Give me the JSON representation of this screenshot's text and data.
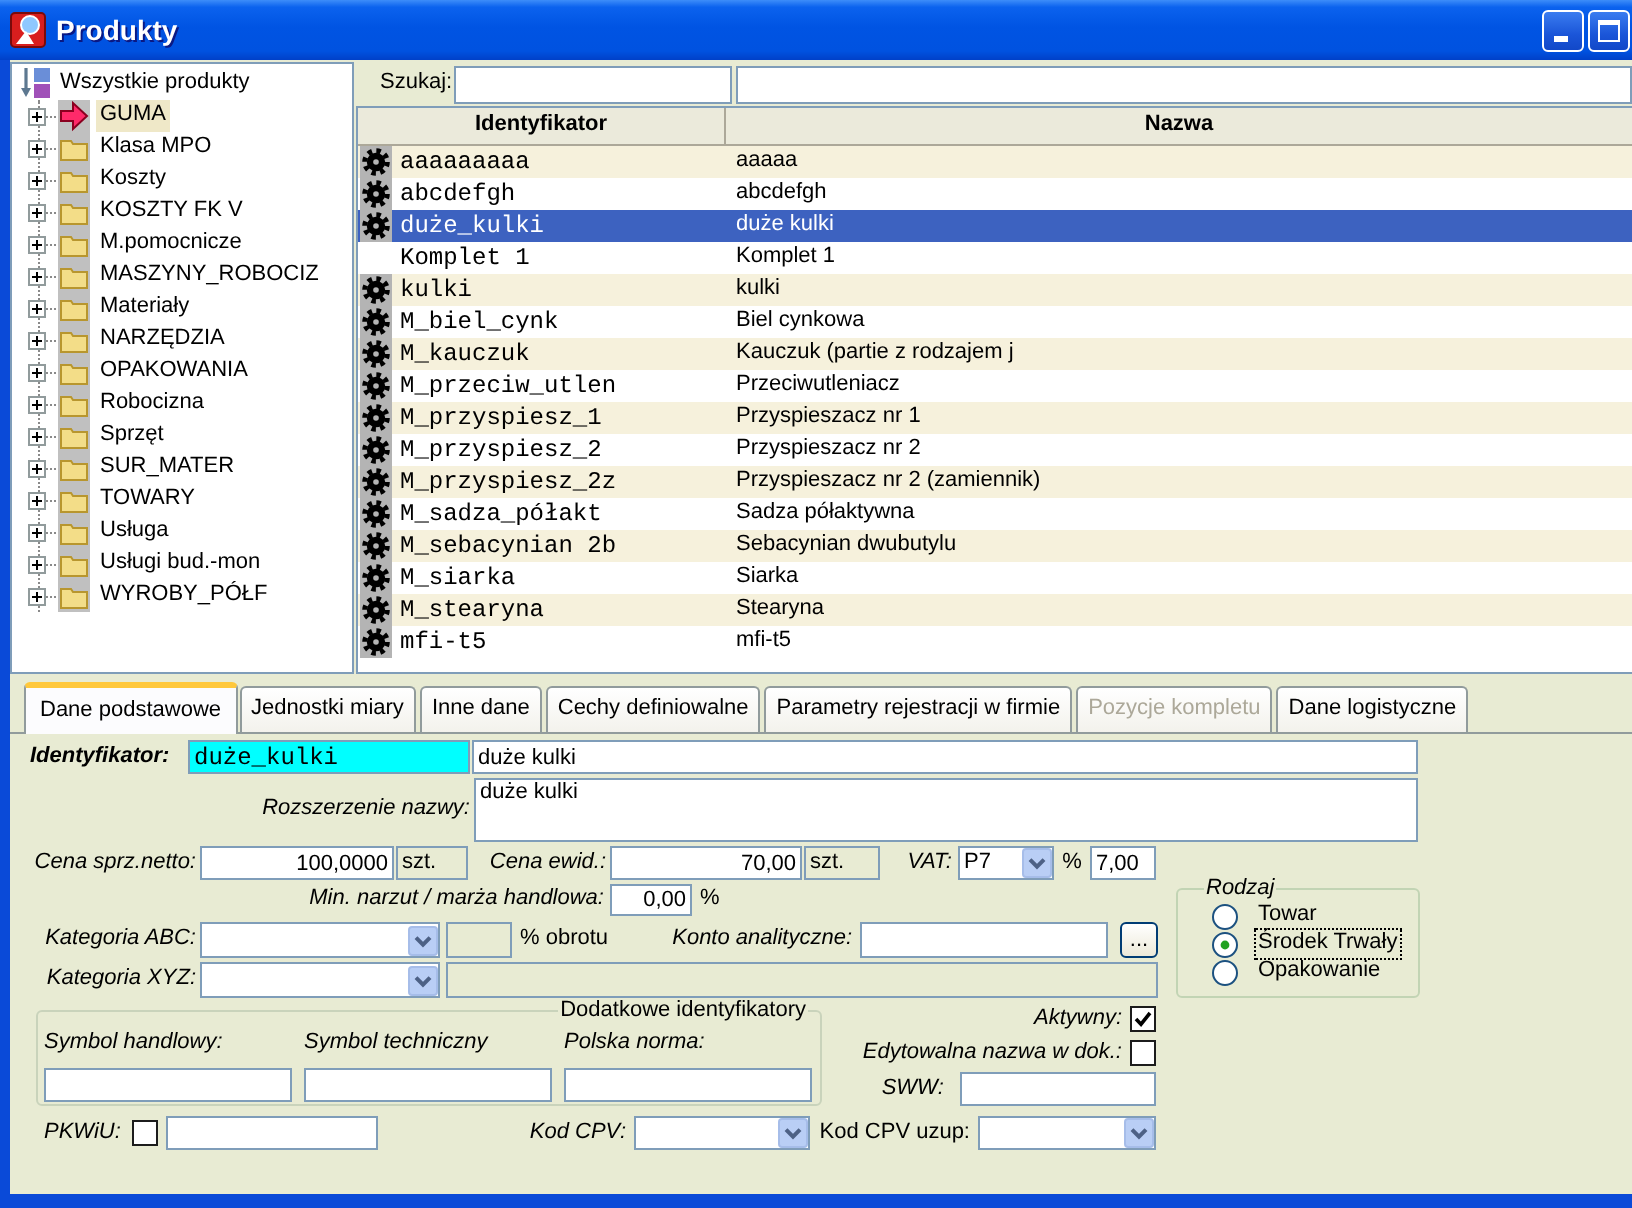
{
  "window": {
    "title": "Produkty"
  },
  "tree": {
    "root": "Wszystkie produkty",
    "items": [
      {
        "label": "GUMA",
        "selected": true,
        "expanded": false
      },
      {
        "label": "Klasa MPO",
        "selected": false,
        "expanded": false
      },
      {
        "label": "Koszty",
        "selected": false,
        "expanded": false
      },
      {
        "label": "KOSZTY FK V",
        "selected": false,
        "expanded": false
      },
      {
        "label": "M.pomocnicze",
        "selected": false,
        "expanded": false
      },
      {
        "label": "MASZYNY_ROBOCIZ",
        "selected": false,
        "expanded": false
      },
      {
        "label": "Materiały",
        "selected": false,
        "expanded": false
      },
      {
        "label": "NARZĘDZIA",
        "selected": false,
        "expanded": false
      },
      {
        "label": "OPAKOWANIA",
        "selected": false,
        "expanded": false
      },
      {
        "label": "Robocizna",
        "selected": false,
        "expanded": false
      },
      {
        "label": "Sprzęt",
        "selected": false,
        "expanded": false
      },
      {
        "label": "SUR_MATER",
        "selected": false,
        "expanded": false
      },
      {
        "label": "TOWARY",
        "selected": false,
        "expanded": false
      },
      {
        "label": "Usługa",
        "selected": false,
        "expanded": false
      },
      {
        "label": "Usługi bud.-mon",
        "selected": false,
        "expanded": false
      },
      {
        "label": "WYROBY_PÓŁF",
        "selected": false,
        "expanded": false
      }
    ]
  },
  "search": {
    "label": "Szukaj:"
  },
  "table": {
    "columns": [
      "Identyfikator",
      "Nazwa"
    ],
    "rows": [
      {
        "id": "aaaaaaaaa",
        "name": "aaaaa",
        "kind": "product",
        "selected": false
      },
      {
        "id": "abcdefgh",
        "name": "abcdefgh",
        "kind": "product",
        "selected": false
      },
      {
        "id": "duże_kulki",
        "name": "duże kulki",
        "kind": "product",
        "selected": true
      },
      {
        "id": "Komplet 1",
        "name": "Komplet 1",
        "kind": "kit",
        "selected": false
      },
      {
        "id": "kulki",
        "name": "kulki",
        "kind": "product",
        "selected": false
      },
      {
        "id": "M_biel_cynk",
        "name": "Biel cynkowa",
        "kind": "product",
        "selected": false
      },
      {
        "id": "M_kauczuk",
        "name": "Kauczuk (partie z rodzajem j",
        "kind": "product",
        "selected": false
      },
      {
        "id": "M_przeciw_utlen",
        "name": "Przeciwutleniacz",
        "kind": "product",
        "selected": false
      },
      {
        "id": "M_przyspiesz_1",
        "name": "Przyspieszacz nr 1",
        "kind": "product",
        "selected": false
      },
      {
        "id": "M_przyspiesz_2",
        "name": "Przyspieszacz nr 2",
        "kind": "product",
        "selected": false
      },
      {
        "id": "M_przyspiesz_2z",
        "name": "Przyspieszacz nr 2 (zamiennik)",
        "kind": "product",
        "selected": false
      },
      {
        "id": "M_sadza_półakt",
        "name": "Sadza półaktywna",
        "kind": "product",
        "selected": false
      },
      {
        "id": "M_sebacynian 2b",
        "name": "Sebacynian dwubutylu",
        "kind": "product",
        "selected": false
      },
      {
        "id": "M_siarka",
        "name": "Siarka",
        "kind": "product",
        "selected": false
      },
      {
        "id": "M_stearyna",
        "name": "Stearyna",
        "kind": "product",
        "selected": false
      },
      {
        "id": "mfi-t5",
        "name": "mfi-t5",
        "kind": "product",
        "selected": false
      }
    ]
  },
  "tabs": [
    {
      "label": "Dane podstawowe",
      "selected": true,
      "disabled": false
    },
    {
      "label": "Jednostki miary",
      "selected": false,
      "disabled": false
    },
    {
      "label": "Inne dane",
      "selected": false,
      "disabled": false
    },
    {
      "label": "Cechy definiowalne",
      "selected": false,
      "disabled": false
    },
    {
      "label": "Parametry rejestracji w firmie",
      "selected": false,
      "disabled": false
    },
    {
      "label": "Pozycje kompletu",
      "selected": false,
      "disabled": true
    },
    {
      "label": "Dane logistyczne",
      "selected": false,
      "disabled": false
    }
  ],
  "form": {
    "identifier": {
      "label": "Identyfikator:",
      "value": "duże_kulki"
    },
    "name": {
      "value": "duże kulki"
    },
    "name_extension": {
      "label": "Rozszerzenie nazwy:",
      "value": "duże kulki"
    },
    "sale_price": {
      "label": "Cena sprz.netto:",
      "value": "100,0000",
      "unit": "szt."
    },
    "book_price": {
      "label": "Cena ewid.:",
      "value": "70,00",
      "unit": "szt."
    },
    "vat": {
      "label": "VAT:",
      "value": "P7",
      "rate_label": "%",
      "rate": "7,00"
    },
    "markup": {
      "label": "Min. narzut / marża handlowa:",
      "value": "0,00",
      "unit": "%"
    },
    "category_abc": {
      "label": "Kategoria ABC:",
      "share_label": "% obrotu"
    },
    "account": {
      "label": "Konto analityczne:",
      "button": "..."
    },
    "category_xyz": {
      "label": "Kategoria XYZ:"
    },
    "extra_ids": {
      "title": "Dodatkowe identyfikatory",
      "fields": [
        {
          "label": "Symbol handlowy:"
        },
        {
          "label": "Symbol techniczny"
        },
        {
          "label": "Polska norma:"
        }
      ]
    },
    "active": {
      "label": "Aktywny:",
      "checked": true
    },
    "editable_name": {
      "label": "Edytowalna nazwa w dok.:",
      "checked": false
    },
    "sww": {
      "label": "SWW:"
    },
    "pkwiu": {
      "label": "PKWiU:",
      "checked": false
    },
    "cpv": {
      "label": "Kod CPV:"
    },
    "cpv_extra": {
      "label": "Kod CPV uzup:"
    },
    "product_type": {
      "title": "Rodzaj",
      "options": [
        {
          "label": "Towar",
          "selected": false
        },
        {
          "label": "Środek Trwały",
          "selected": true
        },
        {
          "label": "Opakowanie",
          "selected": false
        }
      ]
    }
  }
}
